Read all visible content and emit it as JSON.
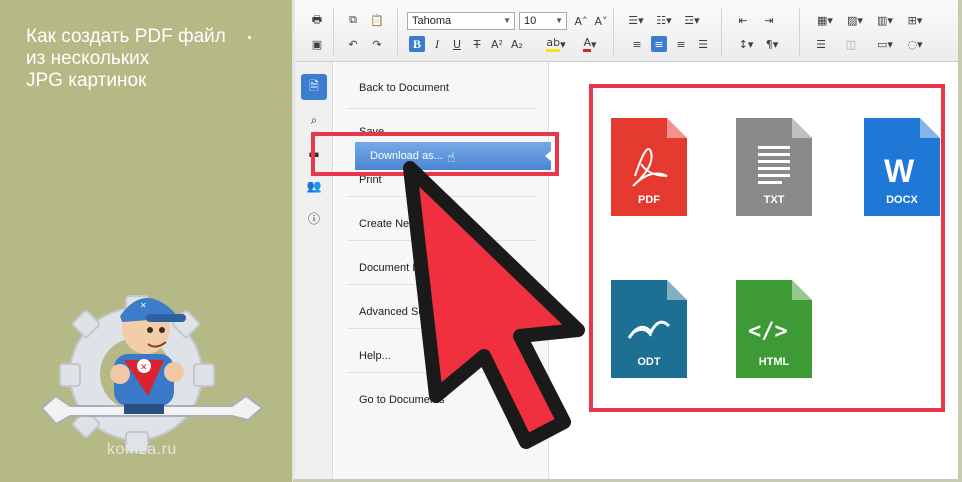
{
  "banner": {
    "title": "Как создать PDF файл\nиз нескольких\nJPG картинок",
    "site": "komza.ru"
  },
  "toolbar": {
    "font_name": "Tahoma",
    "font_size": "10",
    "icons": [
      "print-icon",
      "copy-icon",
      "paste-icon",
      "save-icon",
      "undo-icon",
      "redo-icon",
      "grow-font-icon",
      "shrink-font-icon",
      "bold-icon",
      "italic-icon",
      "underline-icon",
      "strikethrough-icon",
      "superscript-icon",
      "subscript-icon",
      "highlight-color-icon",
      "text-color-icon",
      "bullet-list-icon",
      "numbered-list-icon",
      "multilevel-list-icon",
      "outdent-icon",
      "indent-icon",
      "align-left-icon",
      "align-center-icon",
      "align-right-icon",
      "justify-icon",
      "line-spacing-icon",
      "paragraph-icon",
      "table-icon",
      "image-icon",
      "chart-icon",
      "symbol-icon",
      "page-layout-icon",
      "shape-icon"
    ]
  },
  "sidebar": {
    "icons": [
      "document-icon",
      "search-icon",
      "comment-icon",
      "users-icon",
      "info-icon"
    ]
  },
  "menu": {
    "items": [
      {
        "label": "Back to Document"
      },
      {
        "label": "Save"
      },
      {
        "label": "Download as..."
      },
      {
        "label": "Print"
      },
      {
        "label": "Create New"
      },
      {
        "label": "Document Info"
      },
      {
        "label": "Advanced Settings"
      },
      {
        "label": "Help..."
      },
      {
        "label": "Go to Documents"
      }
    ]
  },
  "formats": {
    "items": [
      {
        "label": "PDF",
        "icon": "pdf-file-icon",
        "color": "#e53a2f"
      },
      {
        "label": "TXT",
        "icon": "txt-file-icon",
        "color": "#8a8a8a"
      },
      {
        "label": "DOCX",
        "icon": "docx-file-icon",
        "color": "#1f77d6"
      },
      {
        "label": "ODT",
        "icon": "odt-file-icon",
        "color": "#1d6f93"
      },
      {
        "label": "HTML",
        "icon": "html-file-icon",
        "color": "#3e9a34"
      }
    ]
  },
  "colors": {
    "background": "#b5b985",
    "highlight": "#e8364b",
    "accent": "#3c7dd1"
  }
}
